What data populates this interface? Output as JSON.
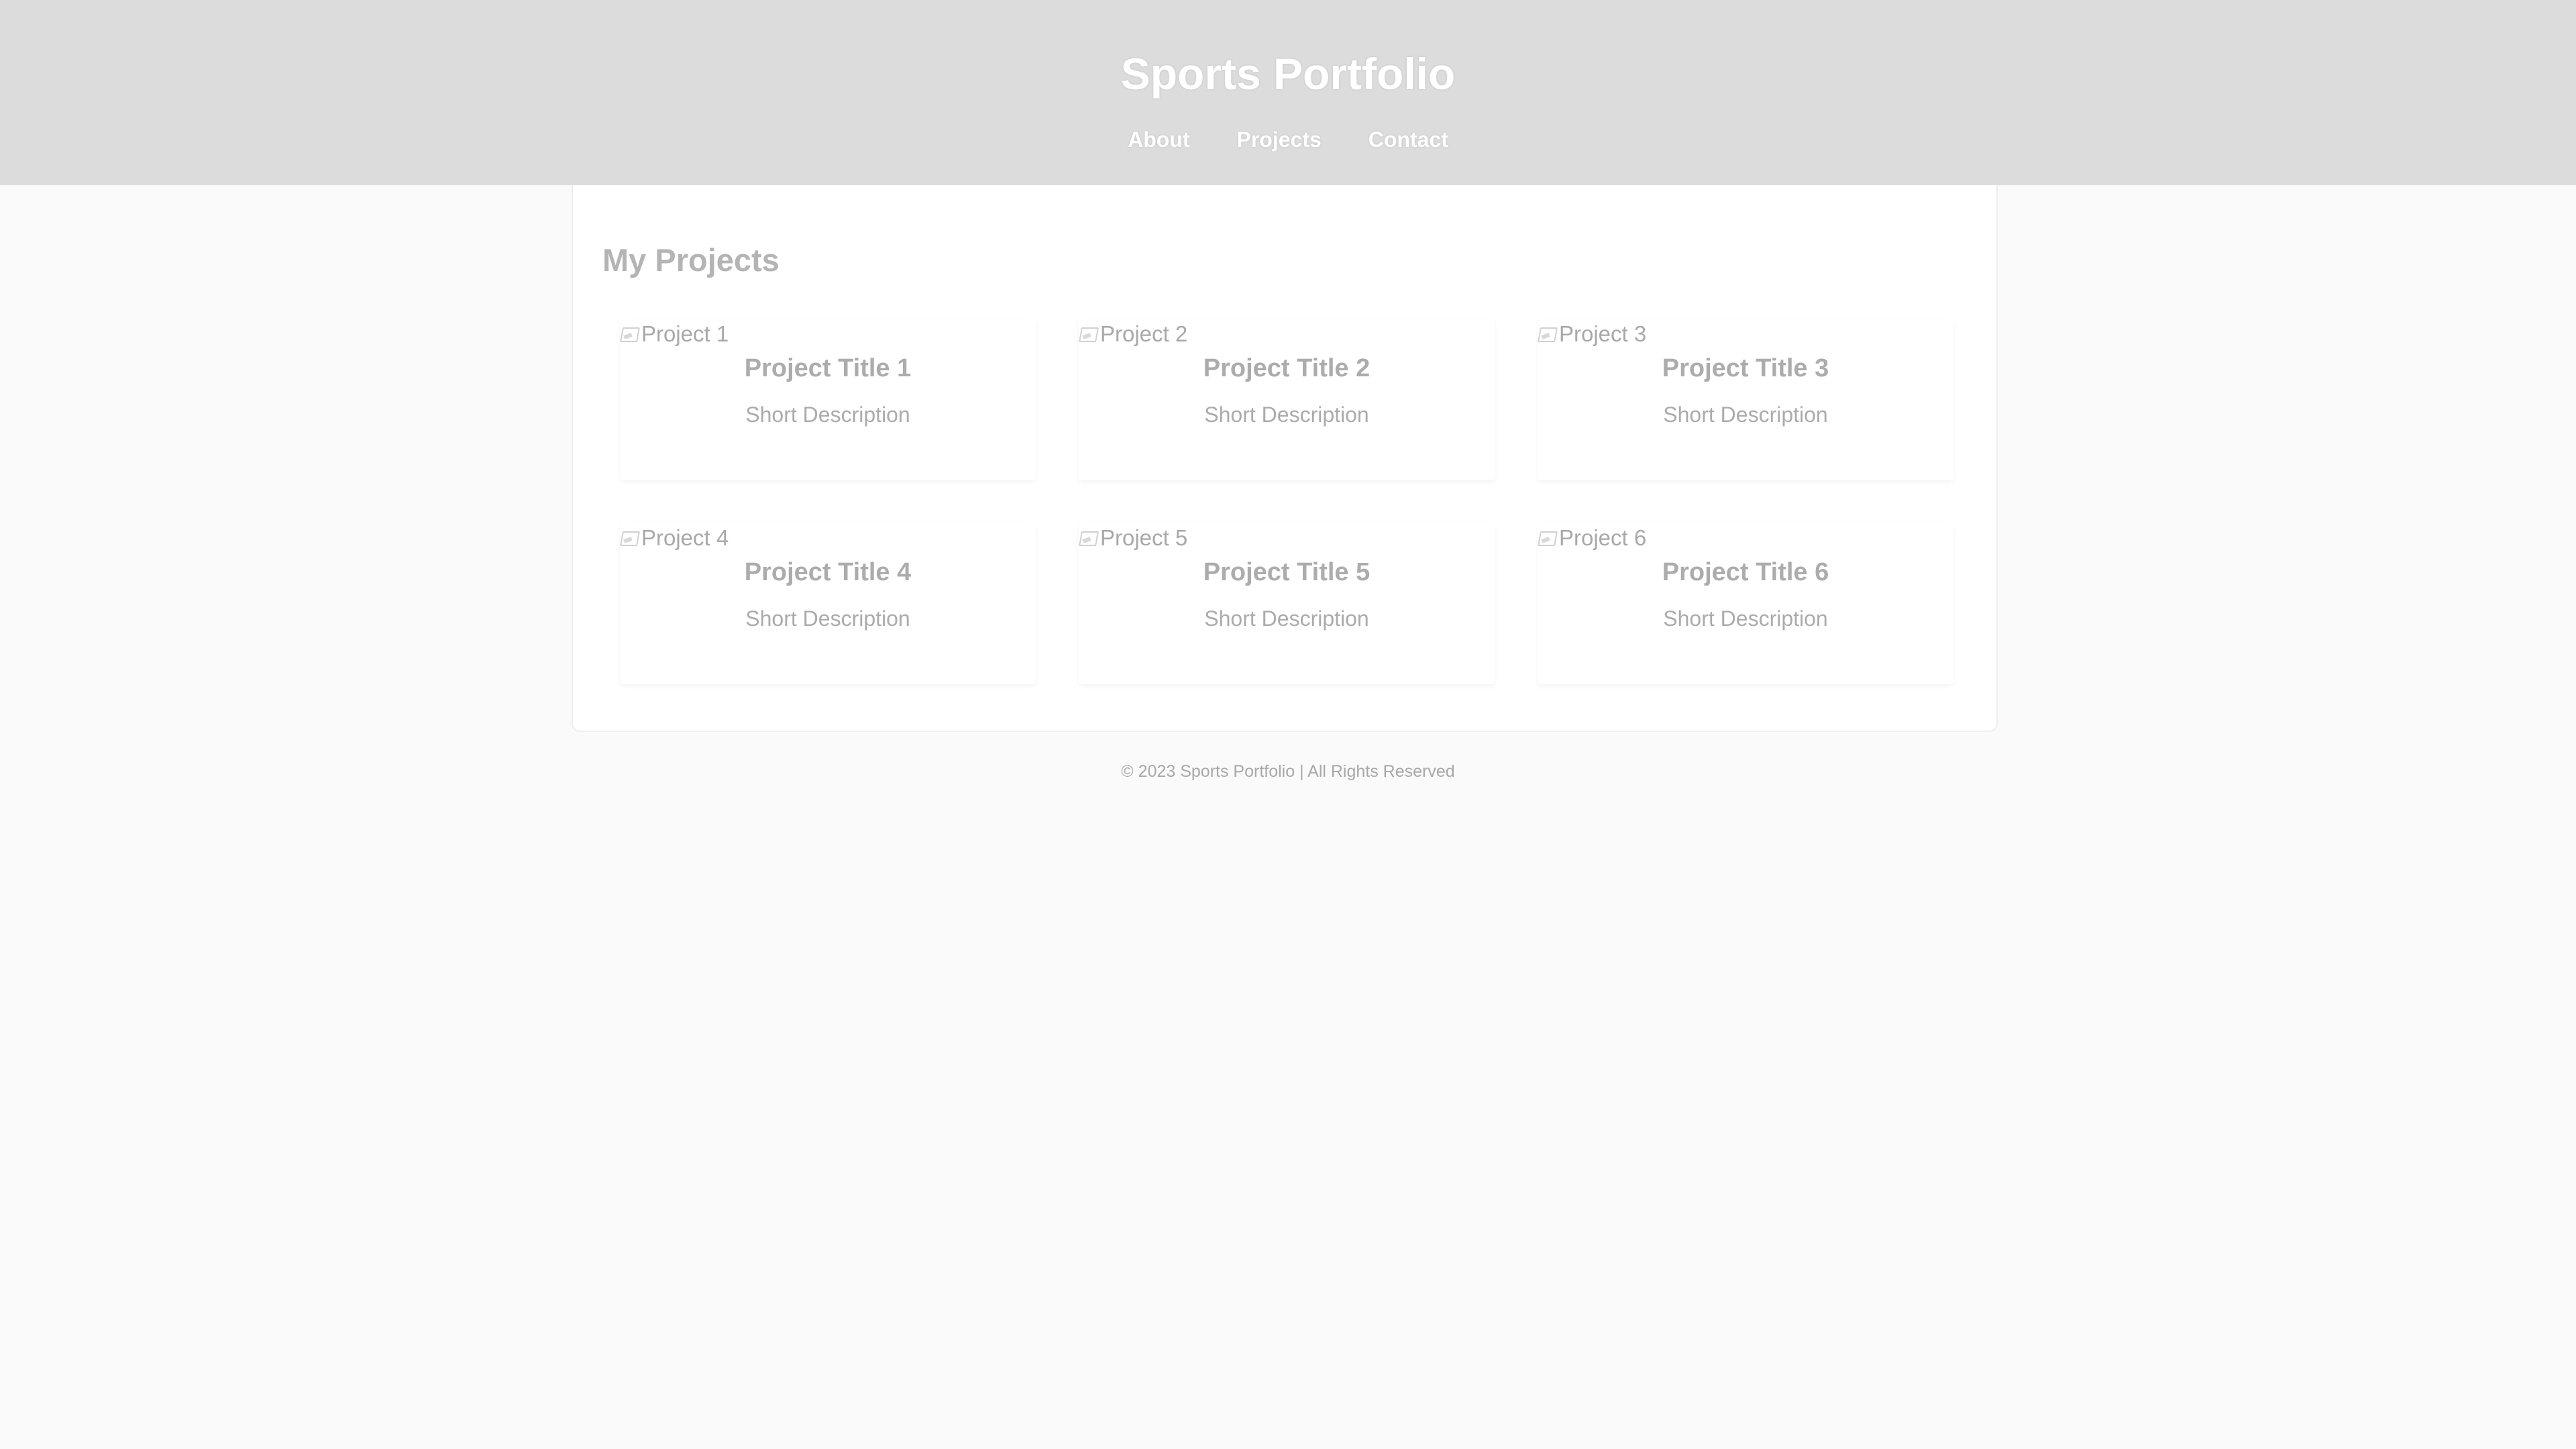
{
  "header": {
    "title": "Sports Portfolio",
    "nav": [
      "About",
      "Projects",
      "Contact"
    ]
  },
  "main": {
    "section_title": "My Projects",
    "projects": [
      {
        "image_alt": "Project 1",
        "title": "Project Title 1",
        "description": "Short Description"
      },
      {
        "image_alt": "Project 2",
        "title": "Project Title 2",
        "description": "Short Description"
      },
      {
        "image_alt": "Project 3",
        "title": "Project Title 3",
        "description": "Short Description"
      },
      {
        "image_alt": "Project 4",
        "title": "Project Title 4",
        "description": "Short Description"
      },
      {
        "image_alt": "Project 5",
        "title": "Project Title 5",
        "description": "Short Description"
      },
      {
        "image_alt": "Project 6",
        "title": "Project Title 6",
        "description": "Short Description"
      }
    ]
  },
  "footer": {
    "text": "© 2023 Sports Portfolio | All Rights Reserved"
  },
  "colors": {
    "header_bg": "#dcdcdc",
    "page_bg": "#fafafa",
    "card_bg": "#ffffff",
    "text_muted": "#acacac"
  },
  "icons": {
    "project_image": "broken-image-icon"
  }
}
